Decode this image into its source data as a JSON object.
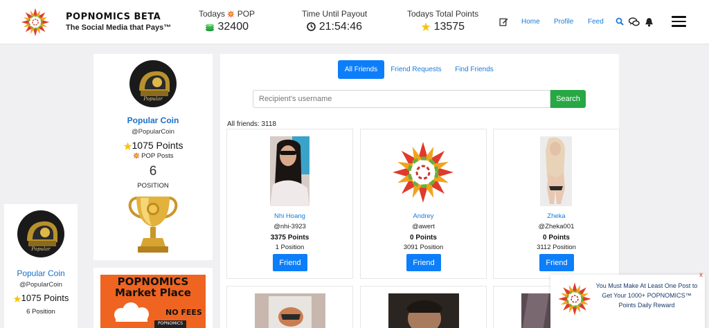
{
  "header": {
    "brand_title": "POPNOMICS BETA",
    "brand_subtitle": "The Social Media that Pays™",
    "stats": {
      "pop": {
        "label_prefix": "Todays",
        "label_suffix": "POP",
        "value": "32400"
      },
      "payout": {
        "label": "Time Until Payout",
        "value": "21:54:46"
      },
      "points": {
        "label": "Todays Total Points",
        "value": "13575"
      }
    },
    "nav": {
      "home": "Home",
      "profile": "Profile",
      "feed": "Feed"
    },
    "icons": [
      "edit-icon",
      "search-icon",
      "chat-icon",
      "bell-icon",
      "hamburger-menu-icon"
    ]
  },
  "mini_profile": {
    "name": "Popular Coin",
    "handle": "@PopularCoin",
    "points": "1075 Points",
    "position": "6 Position"
  },
  "profile": {
    "name": "Popular Coin",
    "handle": "@PopularCoin",
    "points": "1075 Points",
    "posts_label": "POP Posts",
    "position_number": "6",
    "position_label": "POSITION"
  },
  "market": {
    "title_line1": "POPNOMICS",
    "title_line2": "Market Place",
    "badge": "NO FEES",
    "mini_brand": "POPNOMICS"
  },
  "tabs": [
    {
      "label": "All Friends",
      "active": true
    },
    {
      "label": "Friend Requests",
      "active": false
    },
    {
      "label": "Find Friends",
      "active": false
    }
  ],
  "search": {
    "placeholder": "Recipient's username",
    "button": "Search"
  },
  "friends_count": "All friends: 3118",
  "friends": [
    {
      "name": "Nhi Hoang",
      "handle": "@nhi-3923",
      "points": "3375 Points",
      "position": "1 Position",
      "button": "Friend"
    },
    {
      "name": "Andrey",
      "handle": "@awert",
      "points": "0 Points",
      "position": "3091 Position",
      "button": "Friend"
    },
    {
      "name": "Zheka",
      "handle": "@Zheka001",
      "points": "0 Points",
      "position": "3112 Position",
      "button": "Friend"
    }
  ],
  "toast": {
    "close": "x",
    "message": "You Must Make At Least One Post to Get Your 1000+ POPNOMICS™ Points Daily Reward"
  },
  "colors": {
    "accent_blue": "#0d7ef9",
    "link_blue": "#1a7ad9",
    "search_green": "#28a745",
    "market_orange": "#ef6420",
    "star_gold": "#f5c518"
  }
}
